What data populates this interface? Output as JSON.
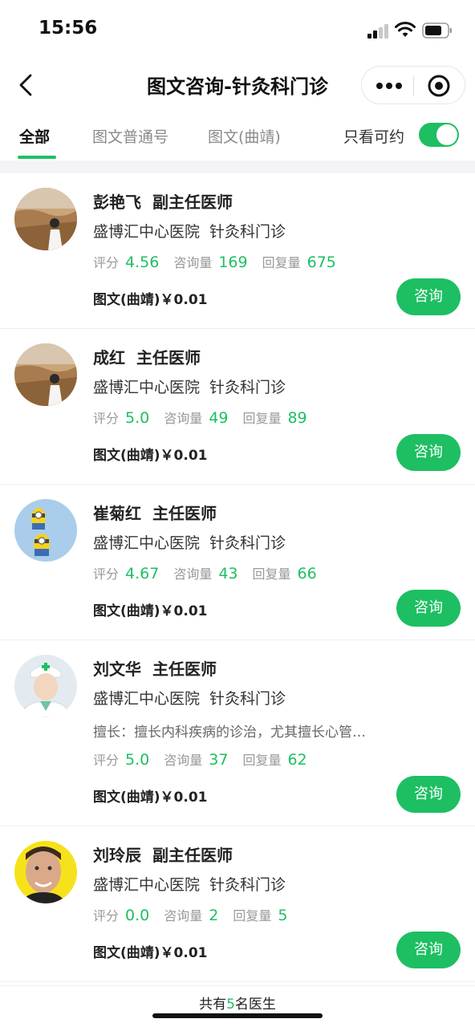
{
  "status_bar": {
    "time": "15:56"
  },
  "nav": {
    "title": "图文咨询-针灸科门诊"
  },
  "tabs": [
    {
      "label": "全部"
    },
    {
      "label": "图文普通号"
    },
    {
      "label": "图文(曲靖)"
    }
  ],
  "filter": {
    "label": "只看可约",
    "enabled": true
  },
  "labels": {
    "rating": "评分",
    "consults": "咨询量",
    "replies": "回复量",
    "consult_button": "咨询"
  },
  "doctors": [
    {
      "name": "彭艳飞",
      "title": "副主任医师",
      "hospital": "盛博汇中心医院",
      "department": "针灸科门诊",
      "rating": "4.56",
      "consults": "169",
      "replies": "675",
      "price": "图文(曲靖)￥0.01"
    },
    {
      "name": "成红",
      "title": "主任医师",
      "hospital": "盛博汇中心医院",
      "department": "针灸科门诊",
      "rating": "5.0",
      "consults": "49",
      "replies": "89",
      "price": "图文(曲靖)￥0.01"
    },
    {
      "name": "崔菊红",
      "title": "主任医师",
      "hospital": "盛博汇中心医院",
      "department": "针灸科门诊",
      "rating": "4.67",
      "consults": "43",
      "replies": "66",
      "price": "图文(曲靖)￥0.01"
    },
    {
      "name": "刘文华",
      "title": "主任医师",
      "hospital": "盛博汇中心医院",
      "department": "针灸科门诊",
      "specialty": "擅长：擅长内科疾病的诊治，尤其擅长心管…",
      "rating": "5.0",
      "consults": "37",
      "replies": "62",
      "price": "图文(曲靖)￥0.01"
    },
    {
      "name": "刘玲辰",
      "title": "副主任医师",
      "hospital": "盛博汇中心医院",
      "department": "针灸科门诊",
      "rating": "0.0",
      "consults": "2",
      "replies": "5",
      "price": "图文(曲靖)￥0.01"
    }
  ],
  "footer": {
    "prefix": "共有",
    "count": "5",
    "suffix": "名医生"
  }
}
